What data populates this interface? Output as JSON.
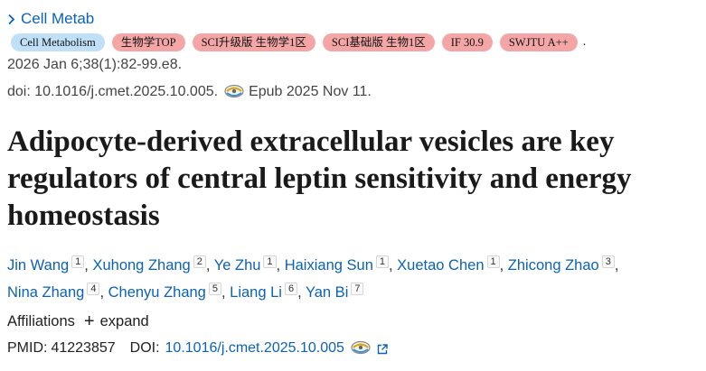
{
  "journal": {
    "link": "Cell Metab"
  },
  "badges": [
    {
      "label": "Cell Metabolism",
      "color": "#bfe0f7"
    },
    {
      "label": "生物学TOP",
      "color": "#f4a6a6"
    },
    {
      "label": "SCI升级版 生物学1区",
      "color": "#f4a6a6"
    },
    {
      "label": "SCI基础版 生物1区",
      "color": "#f4a6a6"
    },
    {
      "label": "IF 30.9",
      "color": "#f4a6a6"
    },
    {
      "label": "SWJTU A++",
      "color": "#f4a6a6"
    }
  ],
  "citation": {
    "trail_dot": ".",
    "line1": "2026 Jan 6;38(1):82-99.e8.",
    "doi_text": "doi: 10.1016/j.cmet.2025.10.005.",
    "epub": "Epub 2025 Nov 11."
  },
  "title": "Adipocyte-derived extracellular vesicles are key regulators of central leptin sensitivity and energy homeostasis",
  "authors": [
    {
      "name": "Jin Wang",
      "aff": "1"
    },
    {
      "name": "Xuhong Zhang",
      "aff": "2"
    },
    {
      "name": "Ye Zhu",
      "aff": "1"
    },
    {
      "name": "Haixiang Sun",
      "aff": "1"
    },
    {
      "name": "Xuetao Chen",
      "aff": "1"
    },
    {
      "name": "Zhicong Zhao",
      "aff": "3"
    },
    {
      "name": "Nina Zhang",
      "aff": "4"
    },
    {
      "name": "Chenyu Zhang",
      "aff": "5"
    },
    {
      "name": "Liang Li",
      "aff": "6"
    },
    {
      "name": "Yan Bi",
      "aff": "7"
    }
  ],
  "affiliations": {
    "label": "Affiliations",
    "plus": "+",
    "expand": "expand"
  },
  "ids": {
    "pmid_label": "PMID:",
    "pmid": "41223857",
    "doi_label": "DOI:",
    "doi": "10.1016/j.cmet.2025.10.005"
  },
  "icons": {
    "journal_chevron": "chevron-right-icon",
    "epub": "crossmark-icon",
    "doi_cross": "crossmark-icon",
    "external": "external-link-icon"
  }
}
